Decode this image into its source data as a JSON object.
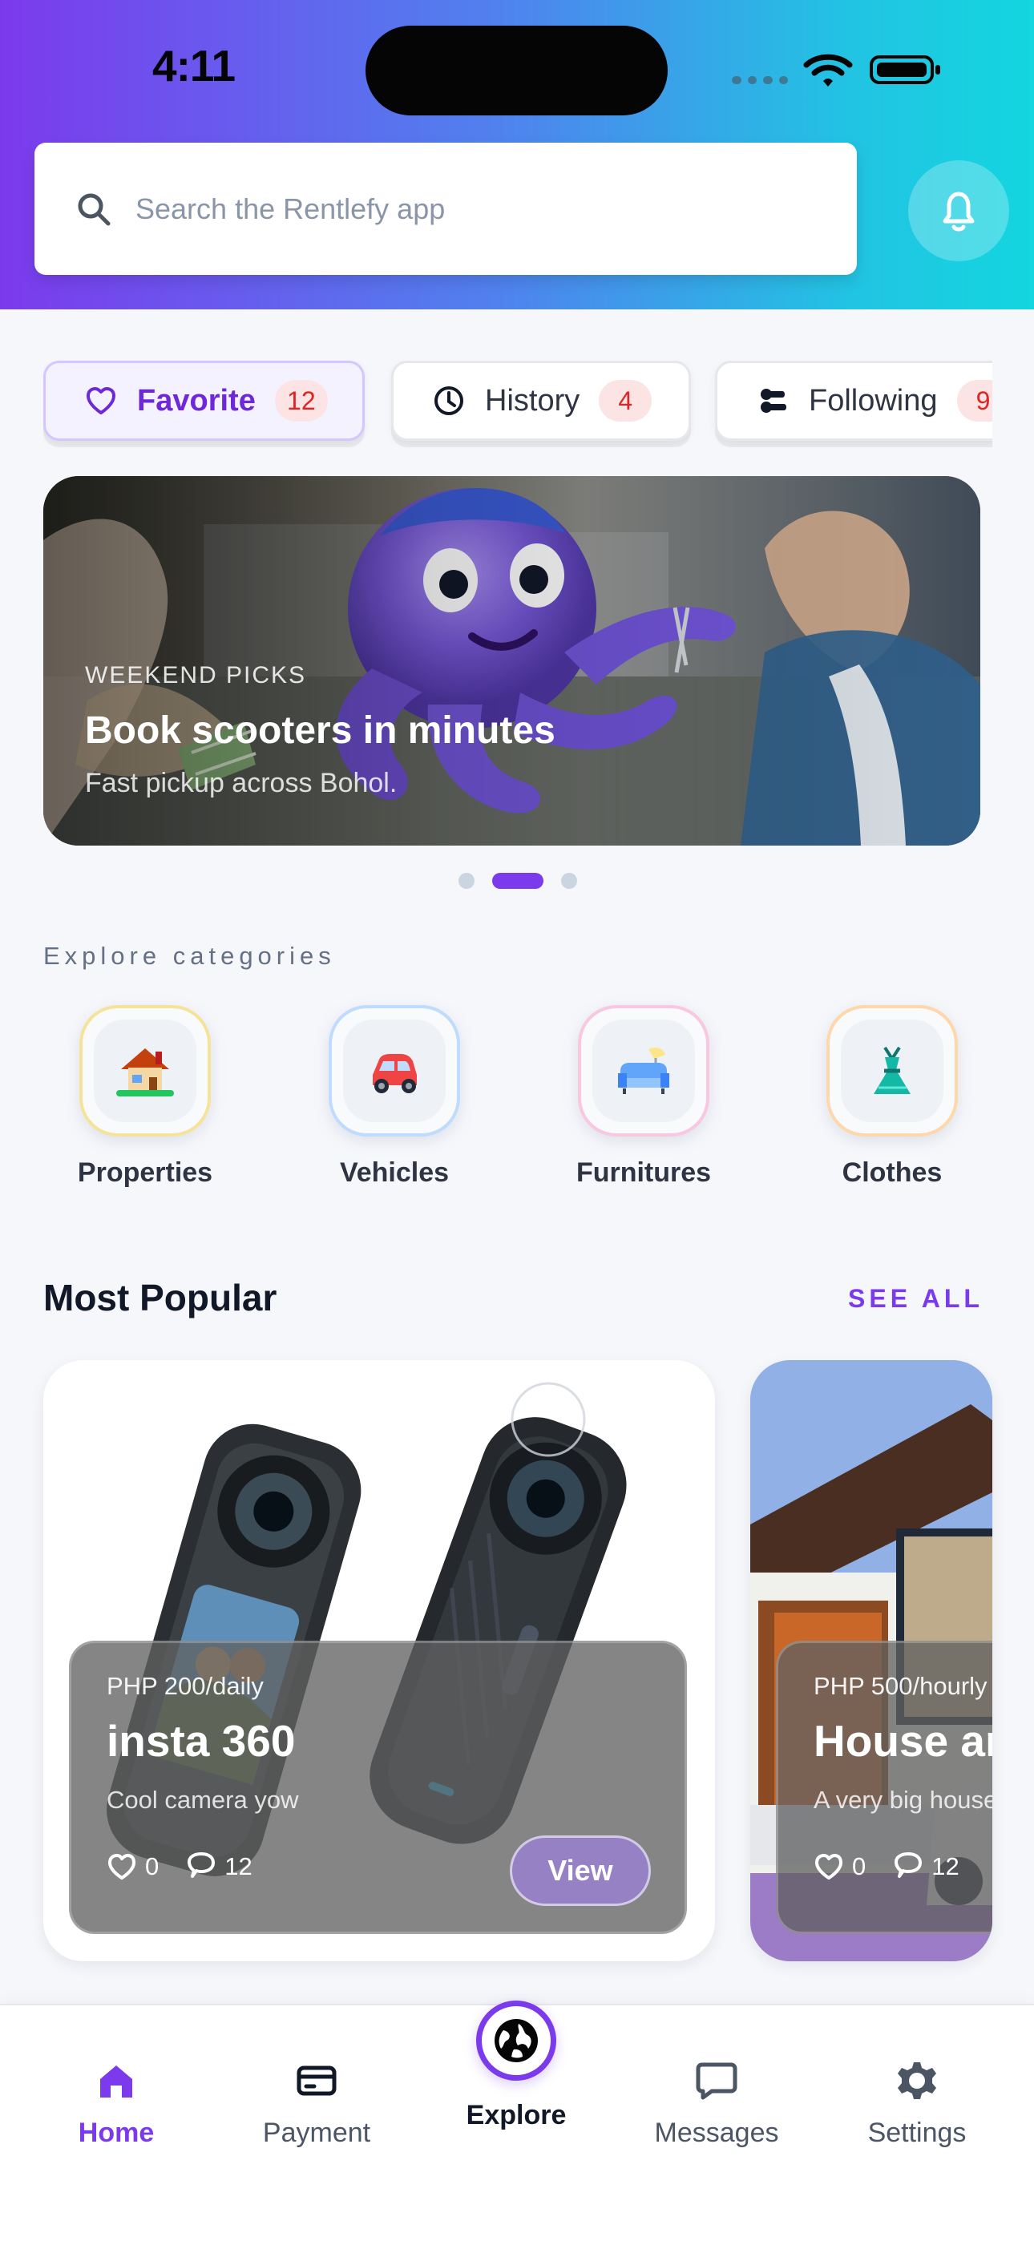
{
  "status_bar": {
    "time": "4:11",
    "signal_icon": "cellular-signal-icon",
    "wifi_icon": "wifi-icon",
    "battery_icon": "battery-icon"
  },
  "header": {
    "search_placeholder": "Search the Rentlefy app",
    "search_icon": "search-icon",
    "notification_icon": "bell-icon",
    "gradient_colors": [
      "#7c3aed",
      "#22c3e3"
    ]
  },
  "quick_filters": [
    {
      "label": "Favorite",
      "count": "12",
      "icon": "heart-icon"
    },
    {
      "label": "History",
      "count": "4",
      "icon": "clock-icon"
    },
    {
      "label": "Following",
      "count": "9",
      "icon": "following-icon"
    }
  ],
  "hero": {
    "kicker": "WEEKEND PICKS",
    "title": "Book scooters in minutes",
    "subtitle": "Fast pickup across Bohol."
  },
  "carousel": {
    "active_index": 1,
    "total": 3
  },
  "categories": {
    "title": "Explore categories",
    "items": [
      {
        "label": "Properties",
        "icon": "house-icon",
        "color": "#f6e39a"
      },
      {
        "label": "Vehicles",
        "icon": "car-icon",
        "color": "#bfdbfe"
      },
      {
        "label": "Furnitures",
        "icon": "sofa-icon",
        "color": "#f9c7df"
      },
      {
        "label": "Clothes",
        "icon": "dress-icon",
        "color": "#fed7aa"
      }
    ]
  },
  "most_popular": {
    "title": "Most Popular",
    "see_all": "SEE ALL",
    "cards": [
      {
        "price": "PHP 200/daily",
        "name": "insta 360",
        "description": "Cool camera yow",
        "likes": "0",
        "comments": "12",
        "action": "View"
      },
      {
        "price": "PHP 500/hourly",
        "name": "House and",
        "description": "A very big house",
        "likes": "0",
        "comments": "12"
      }
    ]
  },
  "bottom_nav": [
    {
      "label": "Home",
      "icon": "home-icon"
    },
    {
      "label": "Payment",
      "icon": "credit-card-icon"
    },
    {
      "label": "Explore",
      "icon": "globe-icon"
    },
    {
      "label": "Messages",
      "icon": "message-icon"
    },
    {
      "label": "Settings",
      "icon": "gear-icon"
    }
  ],
  "theme": {
    "accent": "#7c3aed",
    "badge_text": "#dc2626",
    "badge_bg": "#fde4e4",
    "muted_text": "#647084"
  }
}
